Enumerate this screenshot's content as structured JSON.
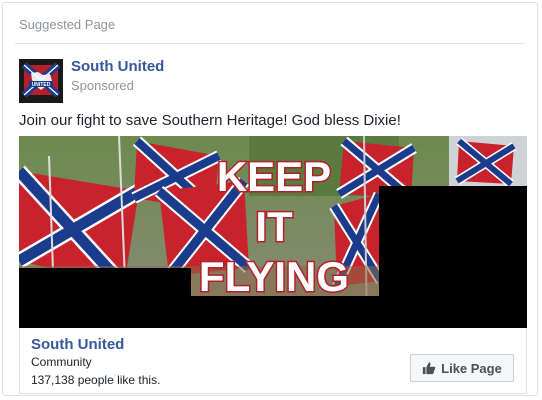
{
  "header": {
    "label": "Suggested Page"
  },
  "post": {
    "page_name": "South United",
    "sponsored_label": "Sponsored",
    "message": "Join our fight to save Southern Heritage! God bless Dixie!",
    "image": {
      "headline_lines": [
        "KEEP",
        "IT",
        "FLYING"
      ],
      "colors": {
        "flag_red": "#c8232c",
        "cross_blue": "#1b3c8c",
        "redaction": "#000000",
        "headline_fill": "#ffffff"
      }
    }
  },
  "footer": {
    "page_name": "South United",
    "category": "Community",
    "likes_text": "137,138 people like this.",
    "like_button_label": "Like Page"
  },
  "icons": {
    "like_button": "thumbs-up-icon",
    "avatar": "flag-logo-icon"
  }
}
